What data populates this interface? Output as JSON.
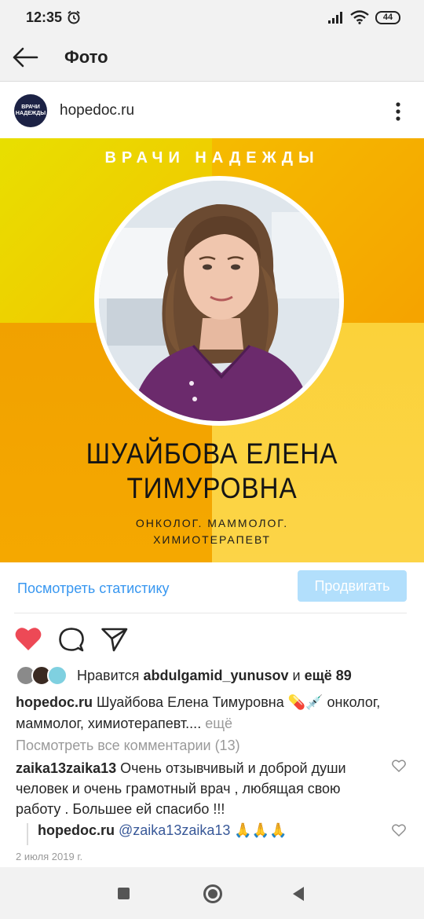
{
  "status_bar": {
    "time": "12:35",
    "battery": "44"
  },
  "header": {
    "title": "Фото"
  },
  "post": {
    "account": "hopedoc.ru",
    "avatar_text": "ВРАЧИ НАДЕЖДЫ",
    "image": {
      "brand": "ВРАЧИ НАДЕЖДЫ",
      "name_line1": "ШУАЙБОВА ЕЛЕНА",
      "name_line2": "ТИМУРОВНА",
      "specialty_line1": "ОНКОЛОГ. МАММОЛОГ.",
      "specialty_line2": "ХИМИОТЕРАПЕВТ"
    },
    "stats_link": "Посмотреть статистику",
    "promote_label": "Продвигать",
    "likes": {
      "prefix": "Нравится",
      "user": "abdulgamid_yunusov",
      "conj": "и",
      "more": "ещё 89"
    },
    "caption": {
      "user": "hopedoc.ru",
      "text": "Шуайбова Елена Тимуровна 💊💉 онколог, маммолог, химиотерапевт....",
      "more": "ещё"
    },
    "view_comments": "Посмотреть все комментарии (13)",
    "comment": {
      "user": "zaika13zaika13",
      "text": "Очень отзывчивый и доброй души человек и очень грамотный врач , любящая свою работу . Большее ей спасибо !!!"
    },
    "reply": {
      "user": "hopedoc.ru",
      "mention": "@zaika13zaika13",
      "emoji": "🙏🙏🙏"
    },
    "date": "2 июля 2019 г."
  },
  "colors": {
    "accent_blue": "#3897f0",
    "promote_button": "#b2dffc",
    "like_red": "#ed4956",
    "banner_yellow": "#f5a600"
  },
  "icons": {
    "back": "arrow-left-icon",
    "more": "more-vertical-icon",
    "like": "heart-filled-icon",
    "comment": "comment-bubble-icon",
    "share": "paper-plane-icon"
  }
}
